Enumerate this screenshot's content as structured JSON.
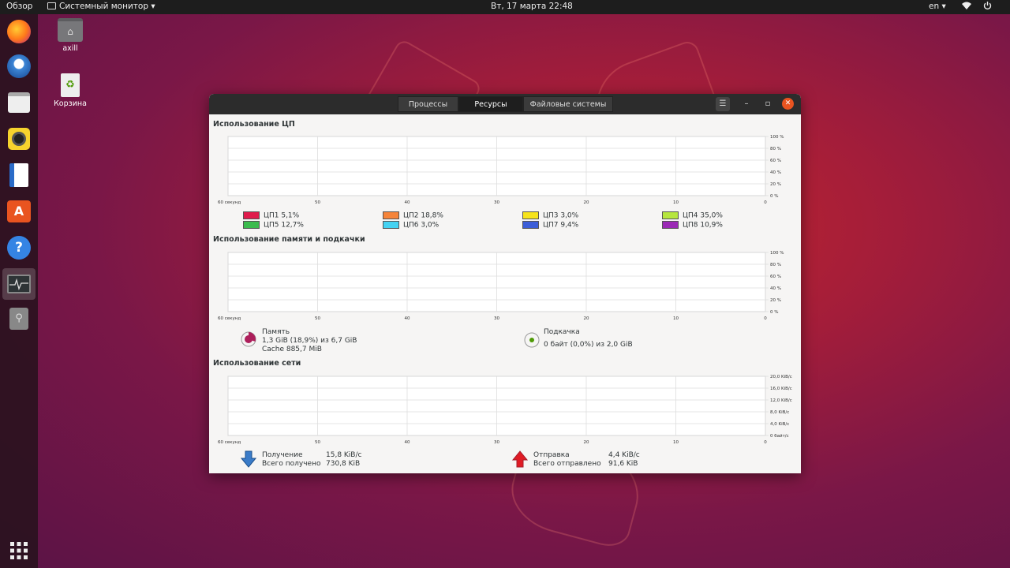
{
  "topbar": {
    "overview": "Обзор",
    "app_menu": "Системный монитор",
    "clock": "Вт, 17 марта  22:48",
    "lang": "en"
  },
  "desktop": {
    "home_label": "axill",
    "trash_label": "Корзина"
  },
  "window": {
    "tabs": [
      {
        "label": "Процессы"
      },
      {
        "label": "Ресурсы"
      },
      {
        "label": "Файловые системы"
      }
    ],
    "active_tab": "Ресурсы",
    "cpu": {
      "title": "Использование ЦП",
      "y_ticks": [
        "100 %",
        "80 %",
        "60 %",
        "40 %",
        "20 %",
        "0 %"
      ],
      "x_ticks": [
        "60 секунд",
        "50",
        "40",
        "30",
        "20",
        "10",
        "0"
      ],
      "legend": [
        {
          "name": "ЦП1",
          "value": "5,1%",
          "color": "#e01b4c"
        },
        {
          "name": "ЦП2",
          "value": "18,8%",
          "color": "#f5843a"
        },
        {
          "name": "ЦП3",
          "value": "3,0%",
          "color": "#f6e31b"
        },
        {
          "name": "ЦП4",
          "value": "35,0%",
          "color": "#b6e63e"
        },
        {
          "name": "ЦП5",
          "value": "12,7%",
          "color": "#3cbc4e"
        },
        {
          "name": "ЦП6",
          "value": "3,0%",
          "color": "#44d2f2"
        },
        {
          "name": "ЦП7",
          "value": "9,4%",
          "color": "#3c5ed8"
        },
        {
          "name": "ЦП8",
          "value": "10,9%",
          "color": "#9b2ab5"
        }
      ]
    },
    "memory": {
      "title": "Использование памяти и подкачки",
      "y_ticks": [
        "100 %",
        "80 %",
        "60 %",
        "40 %",
        "20 %",
        "0 %"
      ],
      "x_ticks": [
        "60 секунд",
        "50",
        "40",
        "30",
        "20",
        "10",
        "0"
      ],
      "mem_label": "Память",
      "mem_value": "1,3 GiB (18,9%) из 6,7 GiB",
      "cache": "Cache 885,7 MiB",
      "mem_color": "#ad1f5b",
      "swap_label": "Подкачка",
      "swap_value": "0 байт (0,0%) из 2,0 GiB",
      "swap_color": "#4e9a06"
    },
    "network": {
      "title": "Использование сети",
      "y_ticks": [
        "20,0 KiB/с",
        "16,0 KiB/с",
        "12,0 KiB/с",
        "8,0 KiB/с",
        "4,0 KiB/с",
        "0 байт/с"
      ],
      "x_ticks": [
        "60 секунд",
        "50",
        "40",
        "30",
        "20",
        "10",
        "0"
      ],
      "recv_label": "Получение",
      "recv_value": "15,8 KiB/с",
      "recv_total_label": "Всего получено",
      "recv_total": "730,8 KiB",
      "send_label": "Отправка",
      "send_value": "4,4 KiB/с",
      "send_total_label": "Всего отправлено",
      "send_total": "91,6 KiB"
    }
  }
}
